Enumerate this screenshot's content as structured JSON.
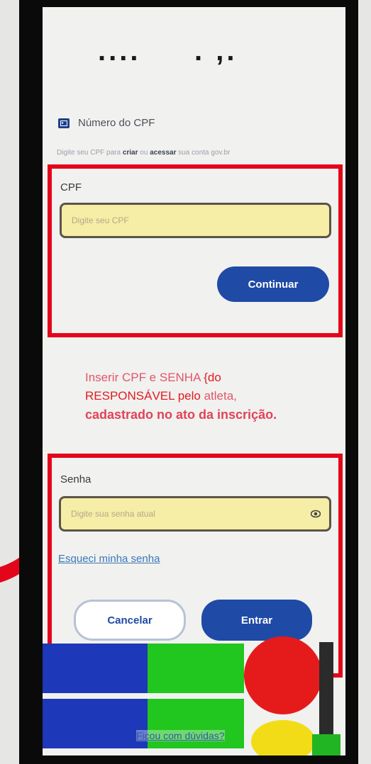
{
  "header": {
    "title": "....     . ,."
  },
  "cpf_section": {
    "title": "Número do CPF",
    "instruction": {
      "part1": "Digite seu CPF para ",
      "criar": "criar",
      "part2": " ou ",
      "acessar": "acessar",
      "part3": " sua conta gov.br"
    },
    "label": "CPF",
    "placeholder": "Digite seu CPF",
    "continue_label": "Continuar"
  },
  "annotation": {
    "line1_a": "Inserir CPF e SENHA ",
    "line1_b": "{do",
    "line2_a": "RESPONSÁVEL  pelo",
    "line2_b": " atleta,",
    "line3": "cadastrado no ato da inscrição."
  },
  "password_section": {
    "label": "Senha",
    "placeholder": "Digite sua senha atual",
    "forgot_label": "Esqueci minha senha",
    "cancel_label": "Cancelar",
    "enter_label": "Entrar"
  },
  "footer": {
    "help_label": "Ficou com dúvidas?"
  },
  "colors": {
    "accent_blue": "#1f4aa6",
    "highlight_red": "#e3061b",
    "input_bg": "#f6eda6"
  }
}
